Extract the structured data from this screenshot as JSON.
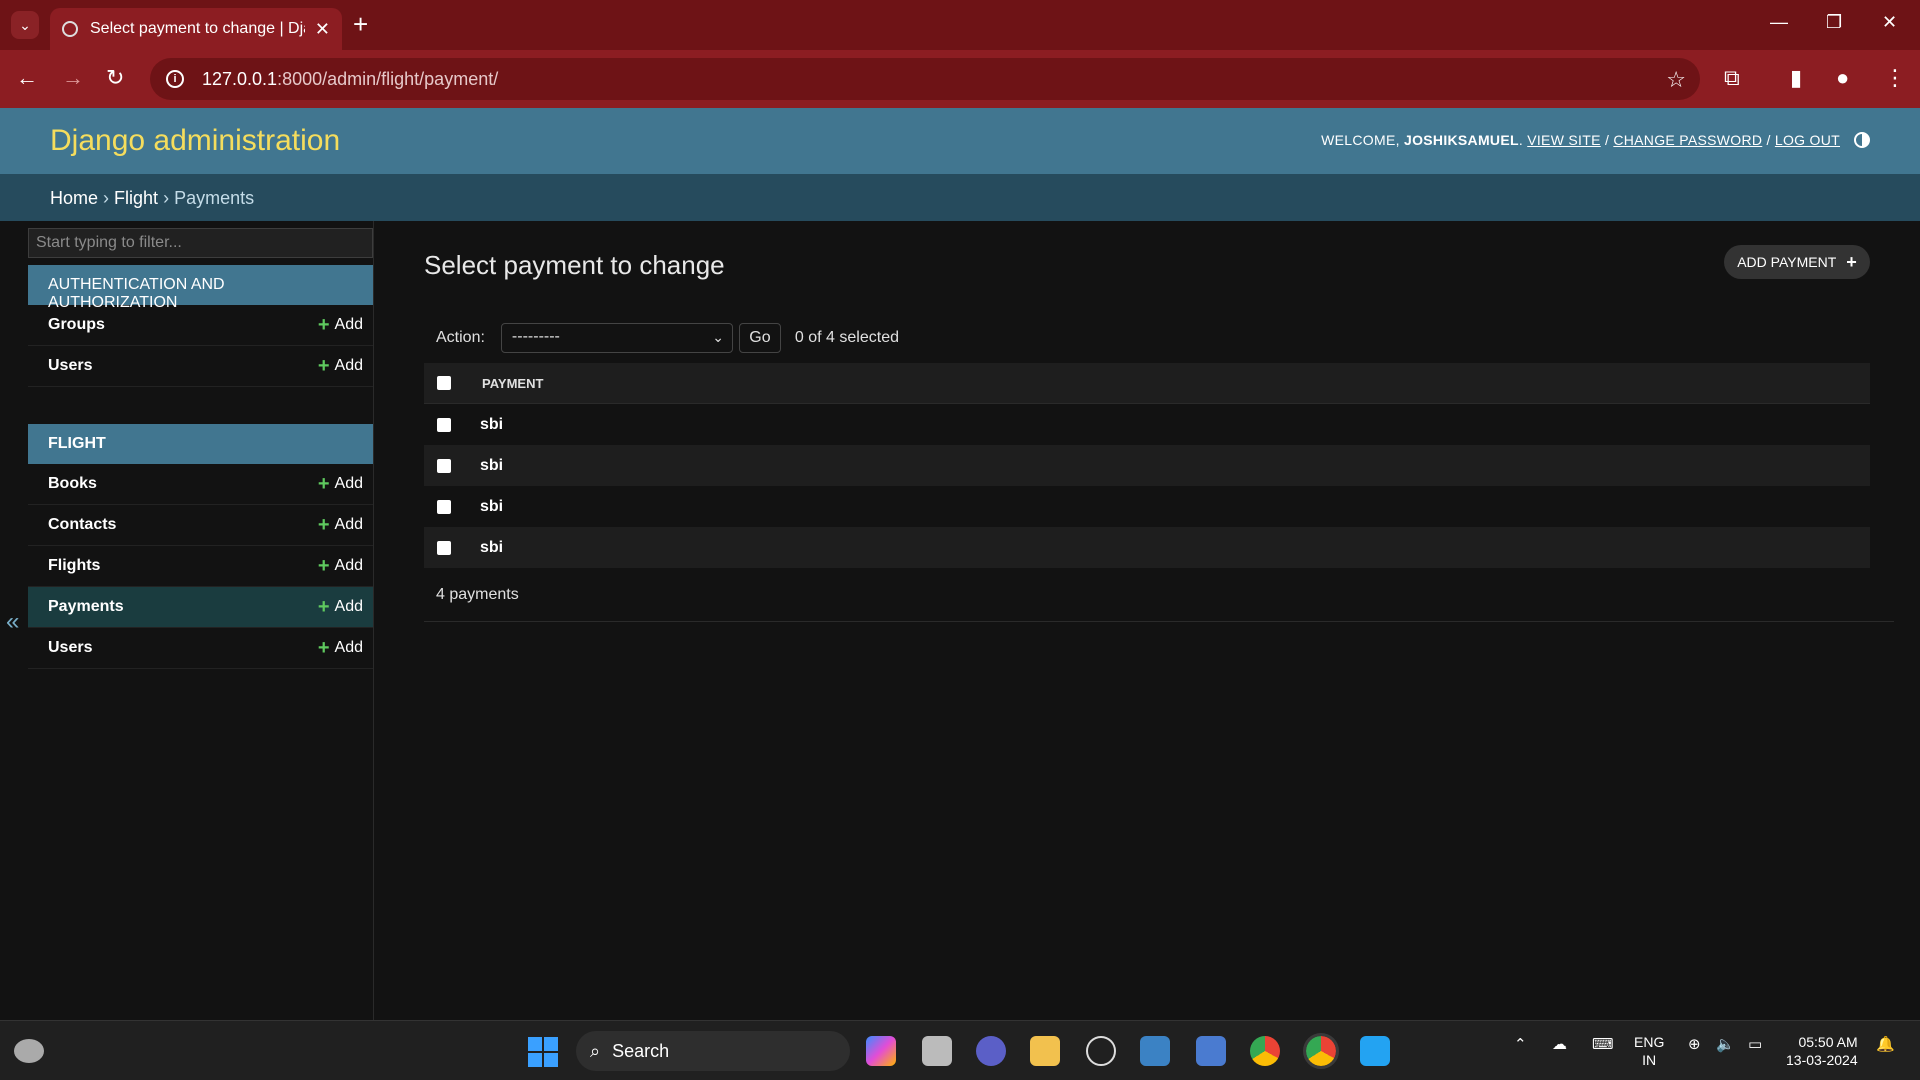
{
  "browser": {
    "tab_title": "Select payment to change | Django site admin",
    "url_host": "127.0.0.1",
    "url_rest": ":8000/admin/flight/payment/"
  },
  "header": {
    "branding": "Django administration",
    "welcome": "WELCOME,",
    "username": "JOSHIKSAMUEL",
    "view_site": "VIEW SITE",
    "change_password": "CHANGE PASSWORD",
    "log_out": "LOG OUT",
    "sep": "/"
  },
  "breadcrumbs": {
    "home": "Home",
    "app": "Flight",
    "current": "Payments",
    "sep": "›"
  },
  "sidebar": {
    "filter_placeholder": "Start typing to filter...",
    "add_label": "Add",
    "apps": [
      {
        "caption": "Authentication and Authorization",
        "models": [
          "Groups",
          "Users"
        ]
      },
      {
        "caption": "Flight",
        "models": [
          "Books",
          "Contacts",
          "Flights",
          "Payments",
          "Users"
        ]
      }
    ],
    "collapse_glyph": "«"
  },
  "content": {
    "title": "Select payment to change",
    "add_button": "Add payment",
    "action_label": "Action:",
    "action_value": "---------",
    "go_label": "Go",
    "selected_count": "0 of 4 selected",
    "column_header": "Payment",
    "rows": [
      "sbi",
      "sbi",
      "sbi",
      "sbi"
    ],
    "paginator": "4 payments"
  },
  "taskbar": {
    "search": "Search",
    "lang_line1": "ENG",
    "lang_line2": "IN",
    "time": "05:50 AM",
    "date": "13-03-2024"
  },
  "colors": {
    "header_bg": "#417690",
    "branding": "#f5dd5d",
    "breadcrumbs_bg": "#264b5d",
    "browser_frame": "#8c1d22",
    "add_plus": "#5fc95f"
  }
}
